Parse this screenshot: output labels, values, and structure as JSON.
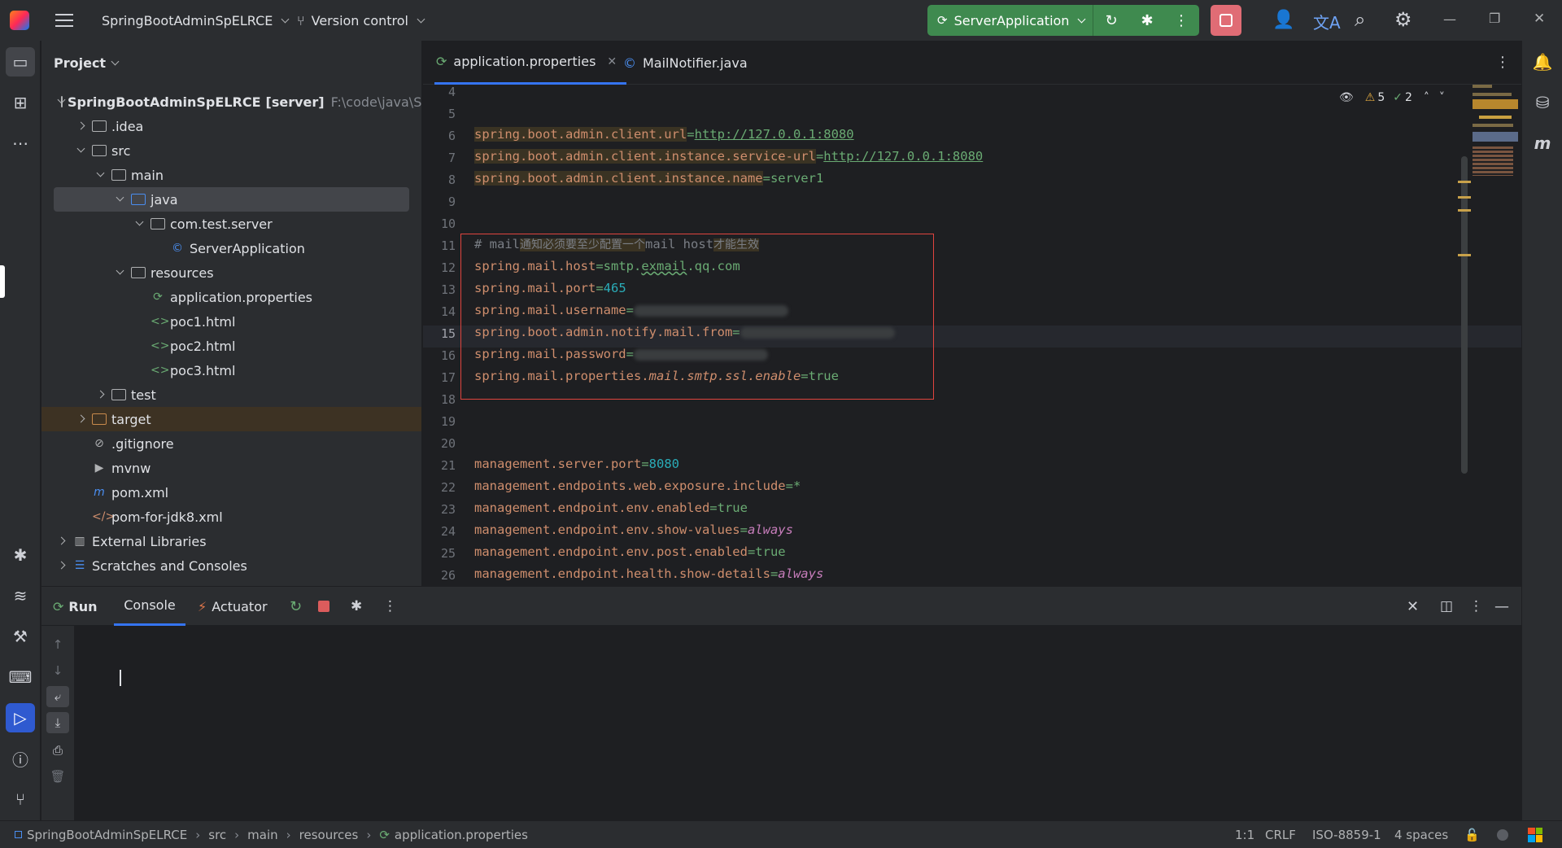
{
  "titlebar": {
    "project_name": "SpringBootAdminSpELRCE",
    "vcs_label": "Version control",
    "run_config": "ServerApplication",
    "minimize": "—",
    "restore": "❐",
    "close": "✕"
  },
  "project_panel": {
    "title": "Project",
    "tree": [
      {
        "label": "SpringBootAdminSpELRCE",
        "suffix": "[server]",
        "path": "F:\\code\\java\\SpringB"
      },
      {
        "label": ".idea"
      },
      {
        "label": "src"
      },
      {
        "label": "main"
      },
      {
        "label": "java"
      },
      {
        "label": "com.test.server"
      },
      {
        "label": "ServerApplication"
      },
      {
        "label": "resources"
      },
      {
        "label": "application.properties"
      },
      {
        "label": "poc1.html"
      },
      {
        "label": "poc2.html"
      },
      {
        "label": "poc3.html"
      },
      {
        "label": "test"
      },
      {
        "label": "target"
      },
      {
        "label": ".gitignore"
      },
      {
        "label": "mvnw"
      },
      {
        "label": "pom.xml"
      },
      {
        "label": "pom-for-jdk8.xml"
      },
      {
        "label": "External Libraries"
      },
      {
        "label": "Scratches and Consoles"
      }
    ]
  },
  "editor": {
    "tabs": [
      {
        "label": "application.properties",
        "active": true
      },
      {
        "label": "MailNotifier.java",
        "active": false
      }
    ],
    "inspections": {
      "warnings": "5",
      "weak_warnings": "2"
    },
    "current_line": "15",
    "lines": [
      {
        "num": "4",
        "text": ""
      },
      {
        "num": "5",
        "text": ""
      },
      {
        "num": "6",
        "key": "spring.boot.admin.client.url",
        "eq": "=",
        "value": "http://127.0.0.1:8080"
      },
      {
        "num": "7",
        "key": "spring.boot.admin.client.instance.service-url",
        "eq": "=",
        "value": "http://127.0.0.1:8080"
      },
      {
        "num": "8",
        "key": "spring.boot.admin.client.instance.name",
        "eq": "=",
        "value": "server1"
      },
      {
        "num": "9",
        "text": ""
      },
      {
        "num": "10",
        "text": ""
      },
      {
        "num": "11",
        "comment_a": "# mail",
        "comment_b": "通知必须要至少配置一个",
        "comment_c": "mail host",
        "comment_d": "才能生效"
      },
      {
        "num": "12",
        "key": "spring.mail.host",
        "eq": "=",
        "value_a": "smtp.",
        "value_b": "exmail",
        "value_c": ".qq.com"
      },
      {
        "num": "13",
        "key": "spring.mail.port",
        "eq": "=",
        "value": "465"
      },
      {
        "num": "14",
        "key": "spring.mail.username",
        "eq": "="
      },
      {
        "num": "15",
        "key": "spring.boot.admin.notify.mail.from",
        "eq": "="
      },
      {
        "num": "16",
        "key": "spring.mail.password",
        "eq": "="
      },
      {
        "num": "17",
        "key": "spring.mail.properties.",
        "key_italic": "mail.smtp.ssl.enable",
        "eq": "=",
        "value": "true"
      },
      {
        "num": "18",
        "text": ""
      },
      {
        "num": "19",
        "text": ""
      },
      {
        "num": "20",
        "text": ""
      },
      {
        "num": "21",
        "key": "management.server.port",
        "eq": "=",
        "value": "8080"
      },
      {
        "num": "22",
        "key": "management.endpoints.web.exposure.include",
        "eq": "=",
        "value": "*"
      },
      {
        "num": "23",
        "key": "management.endpoint.env.enabled",
        "eq": "=",
        "value": "true"
      },
      {
        "num": "24",
        "key": "management.endpoint.env.show-values",
        "eq": "=",
        "value": "always"
      },
      {
        "num": "25",
        "key": "management.endpoint.env.post.enabled",
        "eq": "=",
        "value": "true"
      },
      {
        "num": "26",
        "key": "management.endpoint.health.show-details",
        "eq": "=",
        "value": "always"
      }
    ]
  },
  "run_panel": {
    "run_label": "Run",
    "tabs": [
      {
        "label": "Console",
        "active": true
      },
      {
        "label": "Actuator",
        "active": false
      }
    ]
  },
  "statusbar": {
    "breadcrumbs": [
      "SpringBootAdminSpELRCE",
      "src",
      "main",
      "resources",
      "application.properties"
    ],
    "position": "1:1",
    "line_sep": "CRLF",
    "encoding": "ISO-8859-1",
    "indent": "4 spaces"
  },
  "colors": {
    "run_green": "#3f8a4f",
    "stop_red": "#e06c75",
    "accent_blue": "#3574f0",
    "key_orange": "#cf8e6d",
    "value_green": "#6aab73",
    "number_cyan": "#2aacb8",
    "highlight_box": "#e0443e"
  }
}
